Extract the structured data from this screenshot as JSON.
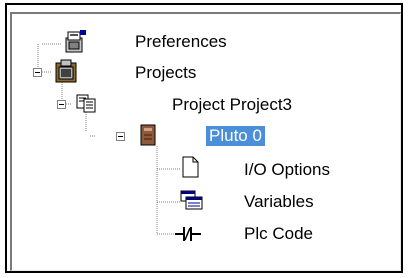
{
  "tree": {
    "items": [
      {
        "label": "Preferences",
        "icon": "preferences-icon",
        "expanded": null
      },
      {
        "label": "Projects",
        "icon": "projects-clipboard-icon",
        "expanded": true
      },
      {
        "label": "Project Project3",
        "icon": "project-copy-icon",
        "expanded": true
      },
      {
        "label": "Pluto 0",
        "icon": "plc-device-icon",
        "expanded": true,
        "selected": true
      },
      {
        "label": "I/O Options",
        "icon": "document-icon",
        "expanded": null
      },
      {
        "label": "Variables",
        "icon": "variables-windows-icon",
        "expanded": null
      },
      {
        "label": "Plc Code",
        "icon": "ladder-contact-icon",
        "expanded": null
      }
    ]
  },
  "colors": {
    "selection": "#4a8fd8",
    "tree_lines": "#808080"
  }
}
